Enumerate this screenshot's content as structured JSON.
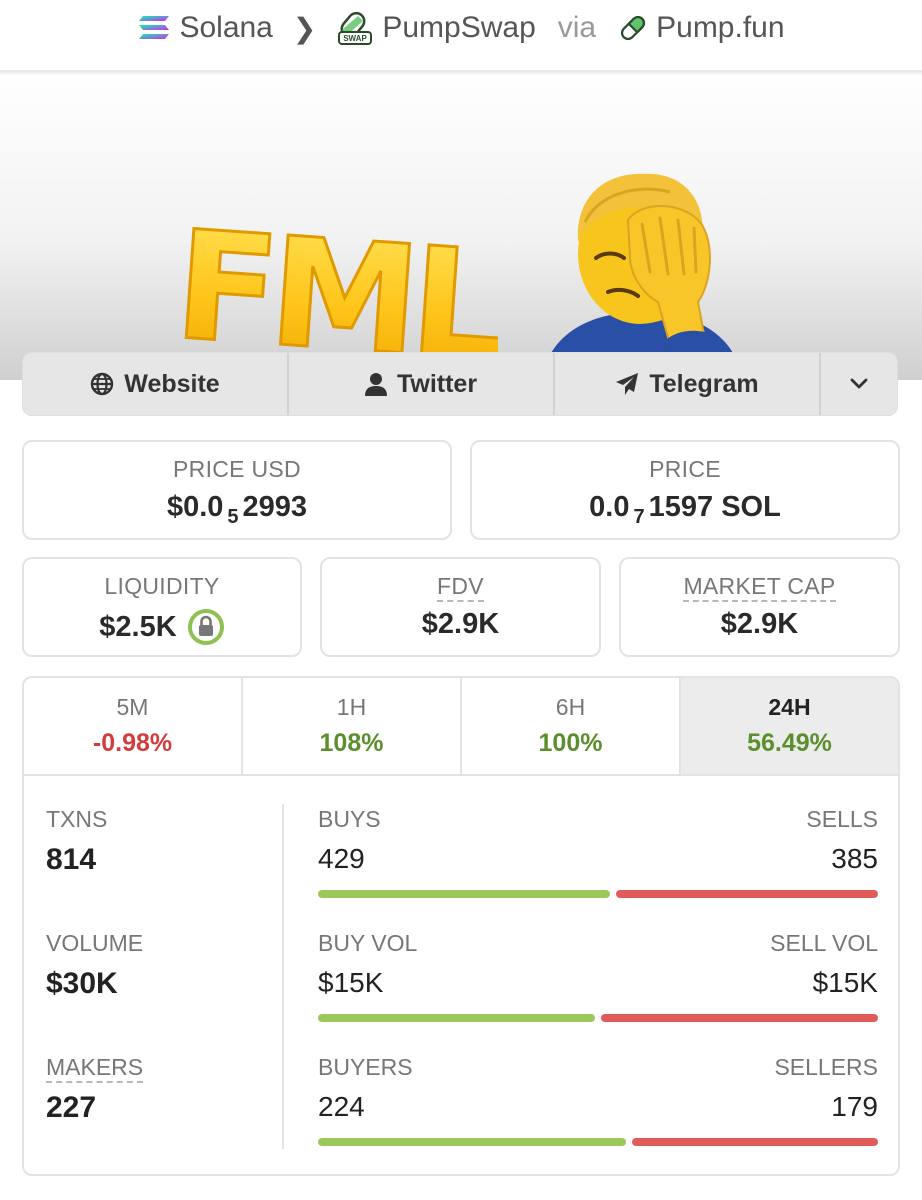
{
  "breadcrumb": {
    "chain": "Solana",
    "dex": "PumpSwap",
    "dex_badge": "SWAP",
    "via": "via",
    "launchpad": "Pump.fun"
  },
  "banner": {
    "logo_text": "FML",
    "emoji": "person-facepalming"
  },
  "links": {
    "website": "Website",
    "twitter": "Twitter",
    "telegram": "Telegram"
  },
  "price_usd": {
    "label": "PRICE USD",
    "prefix": "$0.0",
    "zeros": "5",
    "digits": "2993"
  },
  "price_sol": {
    "label": "PRICE",
    "prefix": "0.0",
    "zeros": "7",
    "digits": "1597 SOL"
  },
  "liquidity": {
    "label": "LIQUIDITY",
    "value": "$2.5K"
  },
  "fdv": {
    "label": "FDV",
    "value": "$2.9K"
  },
  "market_cap": {
    "label": "MARKET CAP",
    "value": "$2.9K"
  },
  "timeframes": [
    {
      "label": "5M",
      "change": "-0.98%",
      "trend": "down"
    },
    {
      "label": "1H",
      "change": "108%",
      "trend": "up"
    },
    {
      "label": "6H",
      "change": "100%",
      "trend": "up"
    },
    {
      "label": "24H",
      "change": "56.49%",
      "trend": "up",
      "selected": true
    }
  ],
  "txns": {
    "label": "TXNS",
    "value": "814"
  },
  "volume": {
    "label": "VOLUME",
    "value": "$30K"
  },
  "makers": {
    "label": "MAKERS",
    "value": "227"
  },
  "buys_sells": {
    "buys_label": "BUYS",
    "buys": "429",
    "sells_label": "SELLS",
    "sells": "385",
    "buy_share": 0.527
  },
  "vol_split": {
    "buy_label": "BUY VOL",
    "buy": "$15K",
    "sell_label": "SELL VOL",
    "sell": "$15K",
    "buy_share": 0.5
  },
  "buyers_sellers": {
    "buyers_label": "BUYERS",
    "buyers": "224",
    "sellers_label": "SELLERS",
    "sellers": "179",
    "buy_share": 0.556
  },
  "colors": {
    "up": "#5b8f2e",
    "down": "#d23c3c",
    "buy_bar": "#9cc85a",
    "sell_bar": "#e15b5b"
  }
}
